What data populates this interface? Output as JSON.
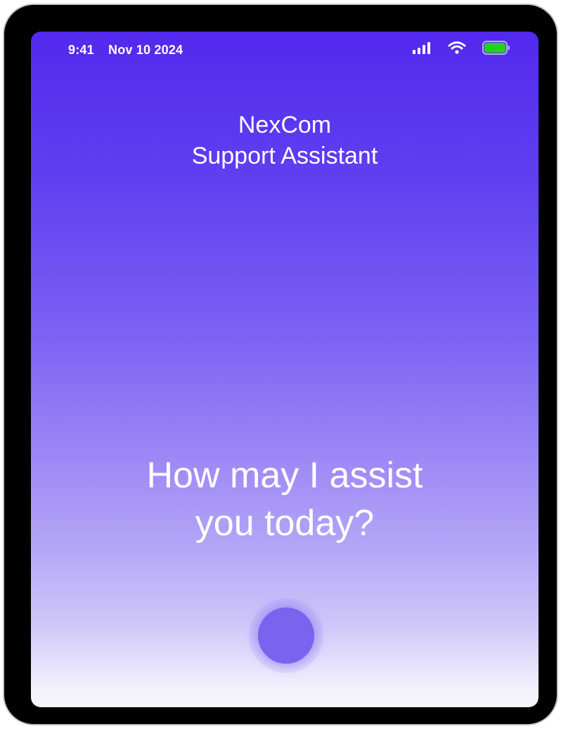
{
  "status_bar": {
    "time": "9:41",
    "date": "Nov 10 2024",
    "icons": [
      "signal-icon",
      "wifi-icon",
      "battery-icon"
    ],
    "battery_color": "#22d11c"
  },
  "header": {
    "app_name": "NexCom",
    "subtitle": "Support Assistant"
  },
  "main": {
    "prompt_line1": "How may I assist",
    "prompt_line2": "you today?"
  },
  "voice": {
    "icon": "voice-orb-icon"
  },
  "colors": {
    "gradient_top": "#5229ee",
    "gradient_bottom": "#f7f6fc",
    "orb": "#7a63ee",
    "text": "#ffffff"
  }
}
